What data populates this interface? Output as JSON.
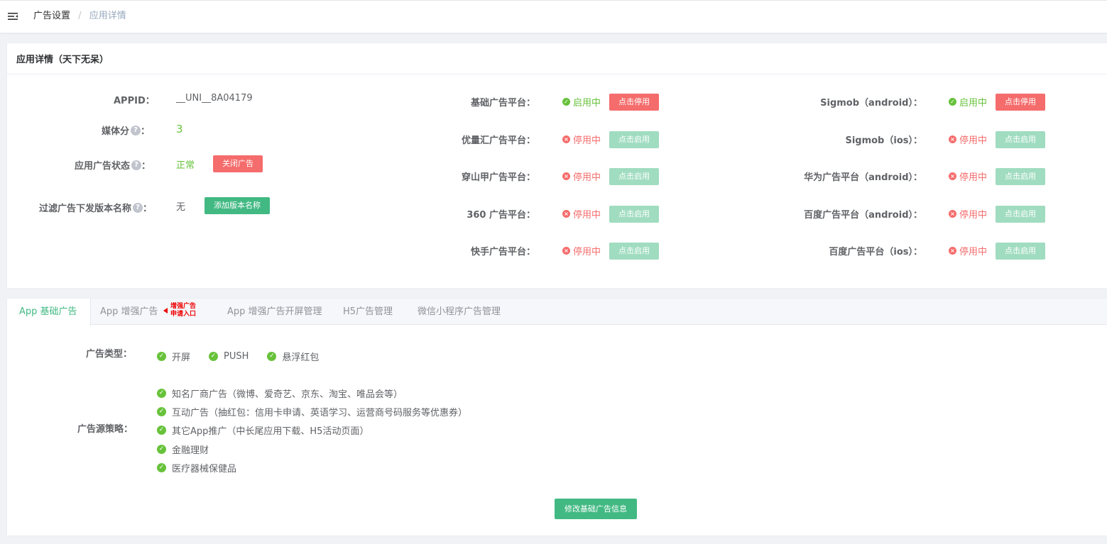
{
  "topbar": {
    "menu_icon": "menu-fold-icon",
    "breadcrumb": {
      "item1": "广告设置",
      "separator": "/",
      "item2": "应用详情"
    }
  },
  "app_card": {
    "title": "应用详情（天下无呆）",
    "fields": {
      "appid_label": "APPID：",
      "appid_value": "__UNI__8A04179",
      "media_score_label": "媒体分",
      "media_score_value": "3",
      "ad_status_label": "应用广告状态",
      "ad_status_value": "正常",
      "ad_status_button": "关闭广告",
      "filter_label": "过滤广告下发版本名称",
      "filter_value": "无",
      "filter_button": "添加版本名称",
      "colon": "：",
      "help_icon": "question-circle-icon"
    },
    "platforms_left": [
      {
        "label": "基础广告平台：",
        "status": "启用中",
        "active": true,
        "button": "点击停用"
      },
      {
        "label": "优量汇广告平台：",
        "status": "停用中",
        "active": false,
        "button": "点击启用"
      },
      {
        "label": "穿山甲广告平台：",
        "status": "停用中",
        "active": false,
        "button": "点击启用"
      },
      {
        "label": "360 广告平台：",
        "status": "停用中",
        "active": false,
        "button": "点击启用"
      },
      {
        "label": "快手广告平台：",
        "status": "停用中",
        "active": false,
        "button": "点击启用"
      }
    ],
    "platforms_right": [
      {
        "label": "Sigmob（android）：",
        "status": "启用中",
        "active": true,
        "button": "点击停用"
      },
      {
        "label": "Sigmob（ios）：",
        "status": "停用中",
        "active": false,
        "button": "点击启用"
      },
      {
        "label": "华为广告平台（android）：",
        "status": "停用中",
        "active": false,
        "button": "点击启用"
      },
      {
        "label": "百度广告平台（android）：",
        "status": "停用中",
        "active": false,
        "button": "点击启用"
      },
      {
        "label": "百度广告平台（ios）：",
        "status": "停用中",
        "active": false,
        "button": "点击启用"
      }
    ]
  },
  "tabs_card": {
    "tabs": [
      {
        "label": "App 基础广告",
        "active": true
      },
      {
        "label": "App 增强广告",
        "active": false
      },
      {
        "label": "App 增强广告开屏管理",
        "active": false
      },
      {
        "label": "H5广告管理",
        "active": false
      },
      {
        "label": "微信小程序广告管理",
        "active": false
      }
    ],
    "annotation": {
      "line1": "增强广告",
      "line2": "申请入口"
    },
    "ad_type_label": "广告类型：",
    "ad_types": [
      "开屏",
      "PUSH",
      "悬浮红包"
    ],
    "strategy_label": "广告源策略：",
    "strategies": [
      "知名厂商广告（微博、爱奇艺、京东、淘宝、唯品会等）",
      "互动广告（抽红包：信用卡申请、英语学习、运营商号码服务等优惠券）",
      "其它App推广（中长尾应用下载、H5活动页面）",
      "金融理财",
      "医疗器械保健品"
    ],
    "submit_button": "修改基础广告信息"
  },
  "colors": {
    "green": "#42b983",
    "green_light": "#a0dcc0",
    "red": "#f56c6c",
    "success": "#67c23a"
  }
}
